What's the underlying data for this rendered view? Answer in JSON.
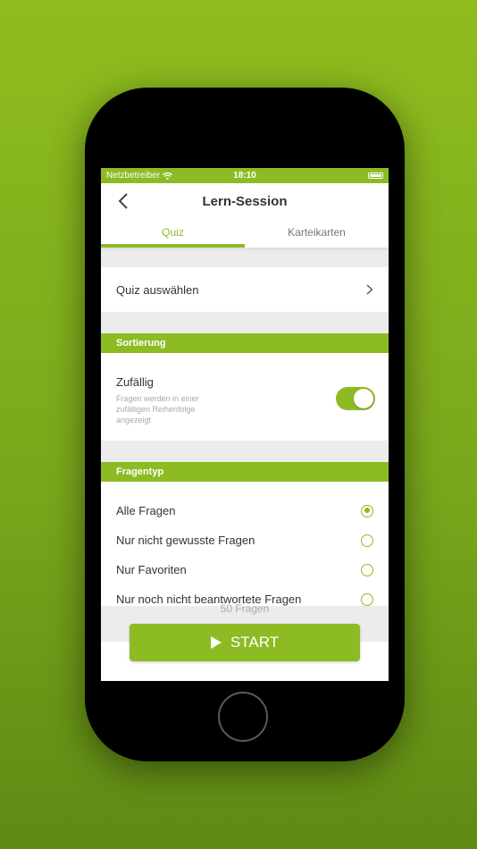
{
  "status_bar": {
    "carrier": "Netzbetreiber",
    "time": "18:10"
  },
  "nav": {
    "title": "Lern-Session"
  },
  "tabs": [
    {
      "label": "Quiz",
      "active": true
    },
    {
      "label": "Karteikarten",
      "active": false
    }
  ],
  "quiz_select": {
    "label": "Quiz auswählen"
  },
  "sorting": {
    "header": "Sortierung",
    "title": "Zufällig",
    "description": "Fragen werden in einer zufälligen Reihenfolge angezeigt",
    "enabled": true
  },
  "question_type": {
    "header": "Fragentyp",
    "options": [
      {
        "label": "Alle Fragen",
        "selected": true
      },
      {
        "label": "Nur nicht gewusste Fragen",
        "selected": false
      },
      {
        "label": "Nur Favoriten",
        "selected": false
      },
      {
        "label": "Nur noch nicht beantwortete Fragen",
        "selected": false
      }
    ]
  },
  "question_count": "50 Fragen",
  "start_button": {
    "label": "START"
  },
  "colors": {
    "accent": "#8dbb24",
    "background": "#8fbd1e"
  },
  "icons": [
    "wifi-icon",
    "battery-icon",
    "back-chevron-icon",
    "chevron-right-icon",
    "play-icon"
  ]
}
